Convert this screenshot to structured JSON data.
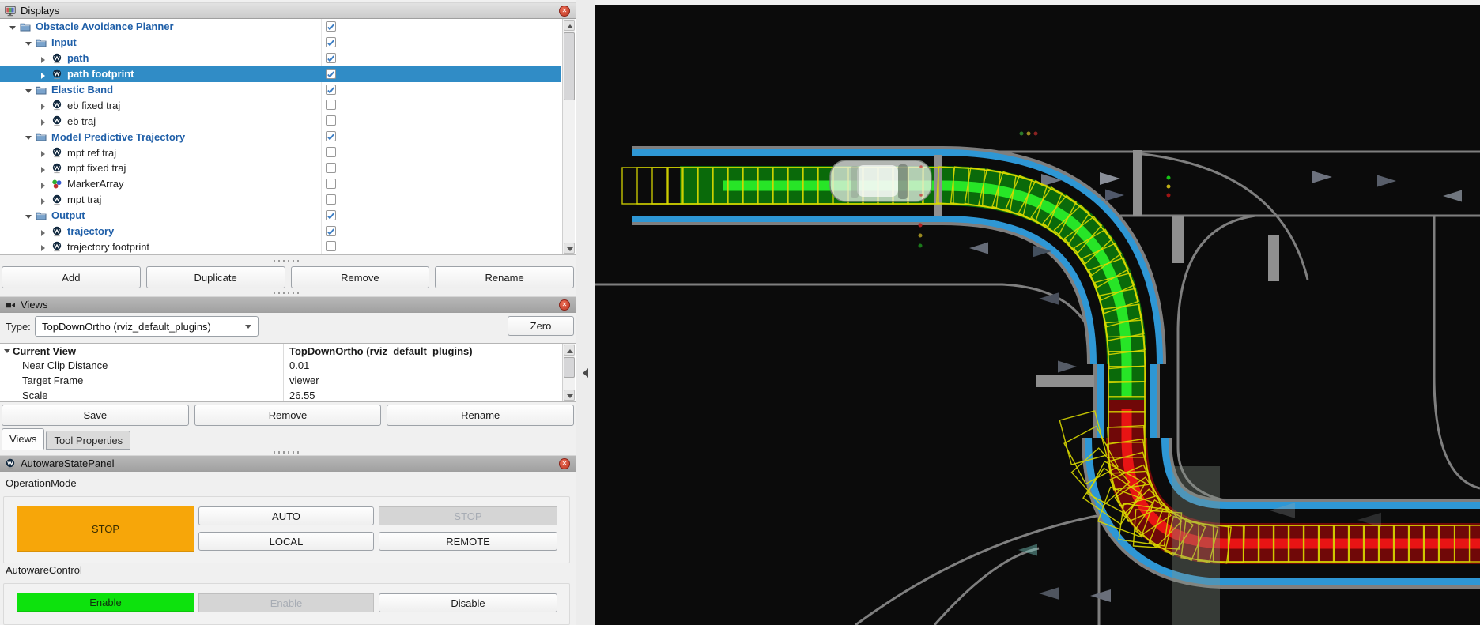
{
  "window": {
    "close_glyph": "✕"
  },
  "displays_panel": {
    "title": "Displays",
    "tree": [
      {
        "label": "Obstacle Avoidance Planner",
        "depth": 0,
        "icon": "folder",
        "expander": "open",
        "checked": true,
        "emph": true,
        "selected": false
      },
      {
        "label": "Input",
        "depth": 1,
        "icon": "folder",
        "expander": "open",
        "checked": true,
        "emph": true,
        "selected": false
      },
      {
        "label": "path",
        "depth": 2,
        "icon": "autoware",
        "expander": "closed",
        "checked": true,
        "emph": true,
        "selected": false
      },
      {
        "label": "path footprint",
        "depth": 2,
        "icon": "autoware",
        "expander": "closed",
        "checked": true,
        "emph": true,
        "selected": true
      },
      {
        "label": "Elastic Band",
        "depth": 1,
        "icon": "folder",
        "expander": "open",
        "checked": true,
        "emph": true,
        "selected": false
      },
      {
        "label": "eb fixed traj",
        "depth": 2,
        "icon": "autoware",
        "expander": "closed",
        "checked": false,
        "emph": false,
        "selected": false
      },
      {
        "label": "eb traj",
        "depth": 2,
        "icon": "autoware",
        "expander": "closed",
        "checked": false,
        "emph": false,
        "selected": false
      },
      {
        "label": "Model Predictive Trajectory",
        "depth": 1,
        "icon": "folder",
        "expander": "open",
        "checked": true,
        "emph": true,
        "selected": false
      },
      {
        "label": "mpt ref traj",
        "depth": 2,
        "icon": "autoware",
        "expander": "closed",
        "checked": false,
        "emph": false,
        "selected": false
      },
      {
        "label": "mpt fixed traj",
        "depth": 2,
        "icon": "autoware",
        "expander": "closed",
        "checked": false,
        "emph": false,
        "selected": false
      },
      {
        "label": "MarkerArray",
        "depth": 2,
        "icon": "markers",
        "expander": "closed",
        "checked": false,
        "emph": false,
        "selected": false
      },
      {
        "label": "mpt traj",
        "depth": 2,
        "icon": "autoware",
        "expander": "closed",
        "checked": false,
        "emph": false,
        "selected": false
      },
      {
        "label": "Output",
        "depth": 1,
        "icon": "folder",
        "expander": "open",
        "checked": true,
        "emph": true,
        "selected": false
      },
      {
        "label": "trajectory",
        "depth": 2,
        "icon": "autoware",
        "expander": "closed",
        "checked": true,
        "emph": true,
        "selected": false
      },
      {
        "label": "trajectory footprint",
        "depth": 2,
        "icon": "autoware",
        "expander": "closed",
        "checked": false,
        "emph": false,
        "selected": false
      }
    ],
    "buttons": [
      "Add",
      "Duplicate",
      "Remove",
      "Rename"
    ]
  },
  "views_panel": {
    "title": "Views",
    "type_label": "Type:",
    "type_value": "TopDownOrtho (rviz_default_plugins)",
    "zero_button": "Zero",
    "properties": [
      {
        "name": "Current View",
        "value": "TopDownOrtho (rviz_default_plugins)",
        "bold": true,
        "expander": true
      },
      {
        "name": "Near Clip Distance",
        "value": "0.01",
        "bold": false,
        "expander": false
      },
      {
        "name": "Target Frame",
        "value": "viewer",
        "bold": false,
        "expander": false
      },
      {
        "name": "Scale",
        "value": "26.55",
        "bold": false,
        "expander": false
      }
    ],
    "buttons": [
      "Save",
      "Remove",
      "Rename"
    ],
    "tabs": [
      {
        "label": "Views",
        "active": true
      },
      {
        "label": "Tool Properties",
        "active": false
      }
    ]
  },
  "state_panel": {
    "title": "AutowareStatePanel",
    "sections": [
      {
        "label": "OperationMode",
        "main_button": {
          "label": "STOP",
          "bg": "#f7a609",
          "fg": "#3a2e00"
        },
        "buttons": [
          {
            "label": "AUTO",
            "disabled": false
          },
          {
            "label": "STOP",
            "disabled": true
          },
          {
            "label": "LOCAL",
            "disabled": false
          },
          {
            "label": "REMOTE",
            "disabled": false
          }
        ]
      },
      {
        "label": "AutowareControl",
        "main_button": {
          "label": "Enable",
          "bg": "#0de20d",
          "fg": "#10320f"
        },
        "buttons": [
          {
            "label": "Enable",
            "disabled": true
          },
          {
            "label": "Disable",
            "disabled": false
          }
        ]
      }
    ]
  },
  "scene": {
    "bg": "#0b0b0b",
    "road_line": "#7f7f7f",
    "corridor_blue": "#2e97d5",
    "traj_green_dark": "#0a6a0a",
    "traj_green": "#27e527",
    "traj_red_dark": "#700808",
    "traj_red": "#e81414",
    "footprint_yellow": "#d8d800",
    "ego_body": "rgba(235,240,235,0.75)",
    "building": "rgba(135,145,135,0.35)",
    "pillar": "#8f8f8f"
  }
}
